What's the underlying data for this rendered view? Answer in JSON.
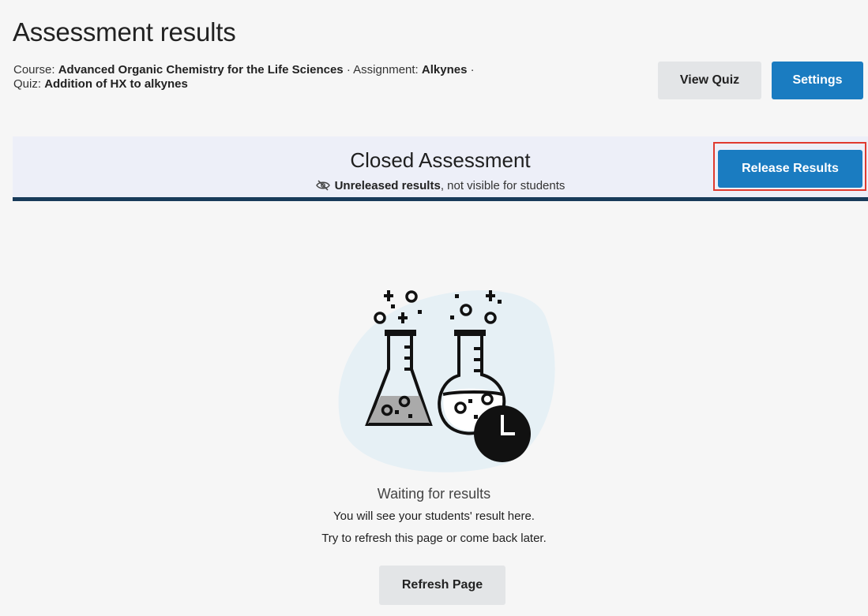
{
  "page": {
    "title": "Assessment results"
  },
  "meta": {
    "course_label": "Course:",
    "course_value": "Advanced Organic Chemistry for the Life Sciences",
    "sep1": "·",
    "assignment_label": "Assignment:",
    "assignment_value": "Alkynes",
    "sep2": "·",
    "quiz_label": "Quiz:",
    "quiz_value": "Addition of HX to alkynes"
  },
  "header_buttons": {
    "view_quiz": "View Quiz",
    "settings": "Settings"
  },
  "banner": {
    "title": "Closed Assessment",
    "status_bold": "Unreleased results",
    "status_rest": ", not visible for students",
    "icon": "eye-off-icon",
    "release_button": "Release Results"
  },
  "empty_state": {
    "illustration": "chemistry-flasks-with-clock",
    "title": "Waiting for results",
    "line1": "You will see your students' result here.",
    "line2": "Try to refresh this page or come back later.",
    "refresh_button": "Refresh Page"
  },
  "colors": {
    "primary_button": "#1a7cc1",
    "secondary_button": "#e3e5e7",
    "banner_bg": "#edeff8",
    "banner_border": "#183b5a",
    "highlight": "#e03a2f"
  }
}
